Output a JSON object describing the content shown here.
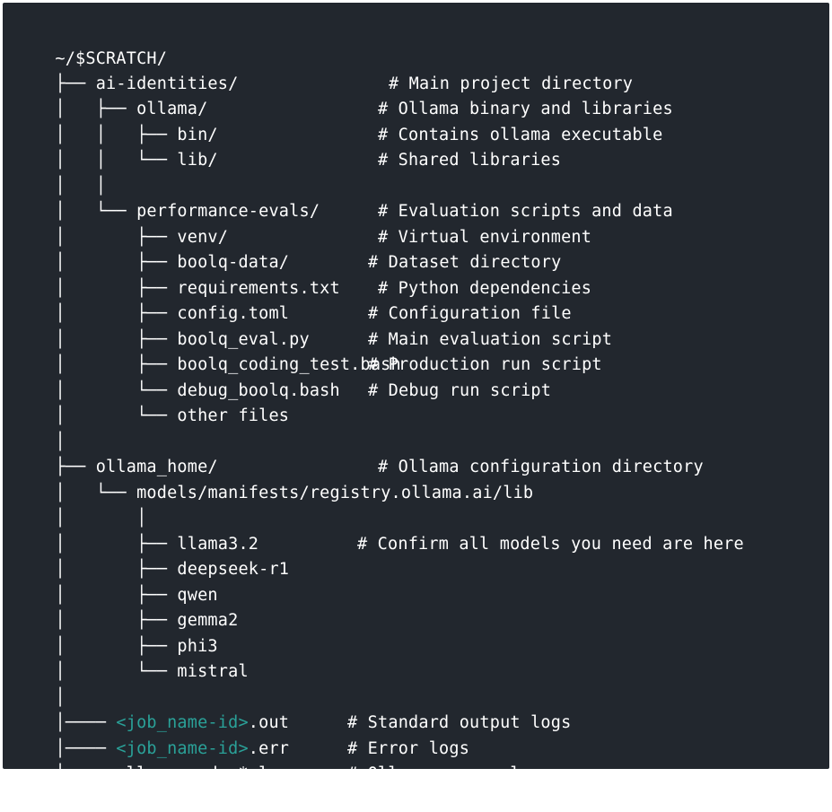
{
  "colors": {
    "panel_background": "#22272e",
    "text": "#ffffff",
    "placeholder_highlight": "#2aa198"
  },
  "tree_lines": [
    {
      "tree": "~/$SCRATCH/",
      "name": "",
      "comment": ""
    },
    {
      "tree": "├── ",
      "name": "ai-identities/",
      "comment": "# Main project directory"
    },
    {
      "tree": "│   ├── ",
      "name": "ollama/",
      "comment": "# Ollama binary and libraries"
    },
    {
      "tree": "│   │   ├── ",
      "name": "bin/",
      "comment": "# Contains ollama executable"
    },
    {
      "tree": "│   │   └── ",
      "name": "lib/",
      "comment": "# Shared libraries"
    },
    {
      "tree": "│   │",
      "name": "",
      "comment": ""
    },
    {
      "tree": "│   └── ",
      "name": "performance-evals/",
      "comment": "# Evaluation scripts and data"
    },
    {
      "tree": "│       ├── ",
      "name": "venv/",
      "comment": "# Virtual environment"
    },
    {
      "tree": "│       ├── ",
      "name": "boolq-data/",
      "comment": "# Dataset directory"
    },
    {
      "tree": "│       ├── ",
      "name": "requirements.txt",
      "comment": "# Python dependencies"
    },
    {
      "tree": "│       ├── ",
      "name": "config.toml",
      "comment": "# Configuration file"
    },
    {
      "tree": "│       ├── ",
      "name": "boolq_eval.py",
      "comment": "# Main evaluation script"
    },
    {
      "tree": "│       ├── ",
      "name": "boolq_coding_test.bash",
      "comment": "# Production run script"
    },
    {
      "tree": "│       └── ",
      "name": "debug_boolq.bash",
      "comment": "# Debug run script"
    },
    {
      "tree": "│       └── ",
      "name": "other files",
      "comment": ""
    },
    {
      "tree": "│",
      "name": "",
      "comment": ""
    },
    {
      "tree": "├── ",
      "name": "ollama_home/",
      "comment": "# Ollama configuration directory"
    },
    {
      "tree": "│   └── ",
      "name": "models/manifests/registry.ollama.ai/lib",
      "comment": ""
    },
    {
      "tree": "│       │",
      "name": "",
      "comment": ""
    },
    {
      "tree": "│       ├── ",
      "name": "llama3.2",
      "comment": "# Confirm all models you need are here"
    },
    {
      "tree": "│       ├── ",
      "name": "deepseek-r1",
      "comment": ""
    },
    {
      "tree": "│       ├── ",
      "name": "qwen",
      "comment": ""
    },
    {
      "tree": "│       ├── ",
      "name": "gemma2",
      "comment": ""
    },
    {
      "tree": "│       ├── ",
      "name": "phi3",
      "comment": ""
    },
    {
      "tree": "│       └── ",
      "name": "mistral",
      "comment": ""
    },
    {
      "tree": "│",
      "name": "",
      "comment": ""
    },
    {
      "tree": "│──── ",
      "placeholder": "<job_name-id>",
      "name": ".out",
      "comment": "# Standard output logs"
    },
    {
      "tree": "│──── ",
      "placeholder": "<job_name-id>",
      "name": ".err",
      "comment": "# Error logs"
    },
    {
      "tree": "│──── ",
      "name": "ollama_node_*.log",
      "comment": "# Ollama server logs"
    }
  ]
}
